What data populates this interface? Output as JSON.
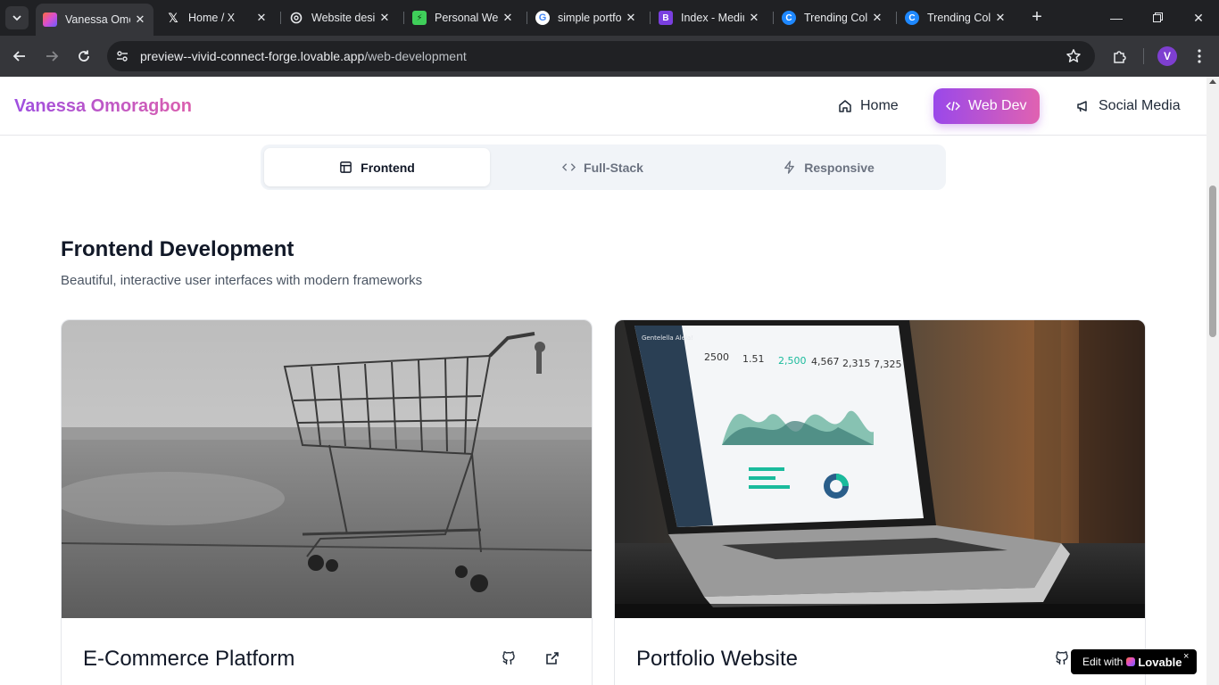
{
  "browser": {
    "tabs": [
      {
        "label": "Vanessa Omoragbon",
        "icon": "lovable-favicon",
        "active": true
      },
      {
        "label": "Home / X",
        "icon": "x-favicon"
      },
      {
        "label": "Website design",
        "icon": "openai-favicon"
      },
      {
        "label": "Personal Website",
        "icon": "green-bolt-favicon"
      },
      {
        "label": "simple portfolio",
        "icon": "google-favicon"
      },
      {
        "label": "Index - Medium",
        "icon": "bootstrap-favicon"
      },
      {
        "label": "Trending Colors",
        "icon": "coolors-favicon"
      },
      {
        "label": "Trending Colors",
        "icon": "coolors-favicon"
      }
    ],
    "url_host": "preview--vivid-connect-forge.lovable.app",
    "url_path": "/web-development",
    "profile_initial": "V"
  },
  "site": {
    "brand": "Vanessa Omoragbon",
    "nav": {
      "home": "Home",
      "webdev": "Web Dev",
      "social": "Social Media"
    },
    "tabs": {
      "frontend": "Frontend",
      "fullstack": "Full-Stack",
      "responsive": "Responsive"
    },
    "section": {
      "title": "Frontend Development",
      "subtitle": "Beautiful, interactive user interfaces with modern frameworks"
    },
    "cards": [
      {
        "title": "E-Commerce Platform"
      },
      {
        "title": "Portfolio Website"
      }
    ],
    "laptop_screen": {
      "brand": "Gentelella Alela!",
      "stats": [
        "2500",
        "1.51",
        "2,500",
        "4,567",
        "2,315",
        "7,325"
      ]
    },
    "badge": {
      "prefix": "Edit with",
      "name": "Lovable",
      "close": "×"
    }
  }
}
